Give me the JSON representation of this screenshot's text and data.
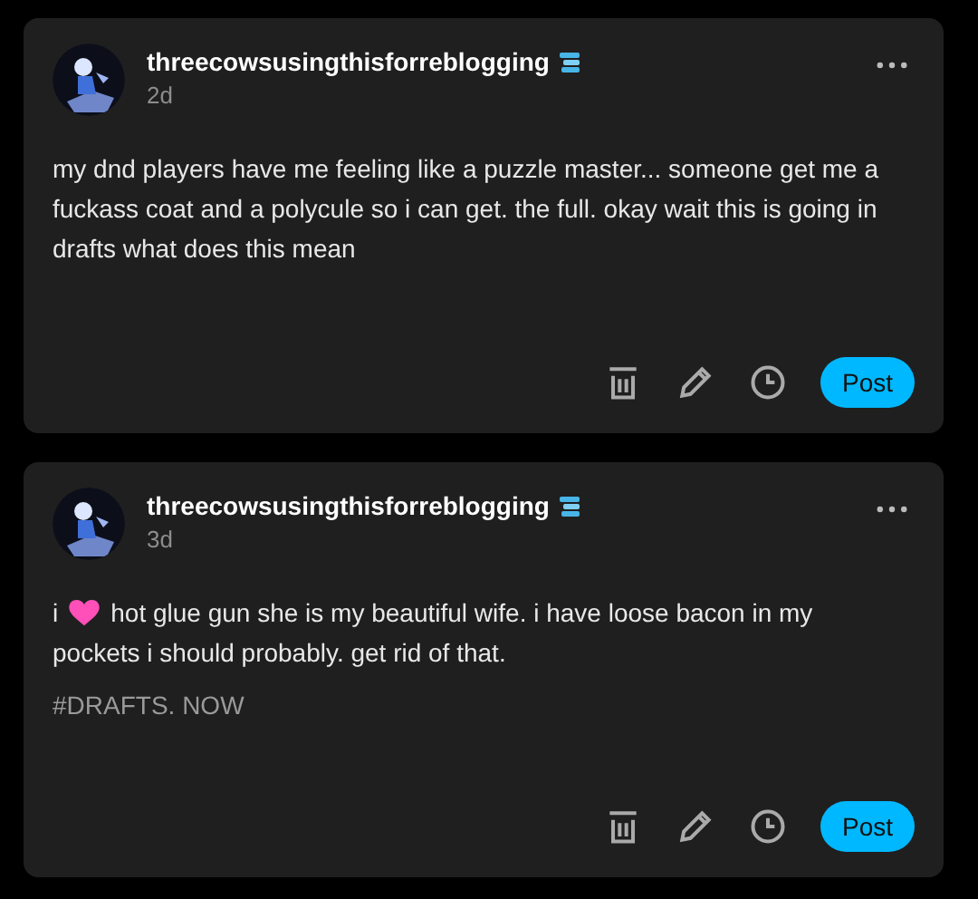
{
  "posts": [
    {
      "username": "threecowsusingthisforreblogging",
      "time": "2d",
      "body": [
        [
          {
            "kind": "text",
            "text": "my dnd players have me feeling like a puzzle master... someone get me a fuckass coat and a polycule so i can get. the full. okay wait this is going in drafts what does this mean"
          }
        ]
      ],
      "post_button": "Post"
    },
    {
      "username": "threecowsusingthisforreblogging",
      "time": "3d",
      "body": [
        [
          {
            "kind": "text",
            "text": "i"
          },
          {
            "kind": "heart"
          },
          {
            "kind": "text",
            "text": "hot glue gun she is my beautiful wife. i have loose bacon in my"
          }
        ],
        [
          {
            "kind": "text",
            "text": "pockets i should probably. get rid of that."
          }
        ]
      ],
      "tags": [
        "#DRAFTS. NOW"
      ],
      "post_button": "Post"
    }
  ]
}
